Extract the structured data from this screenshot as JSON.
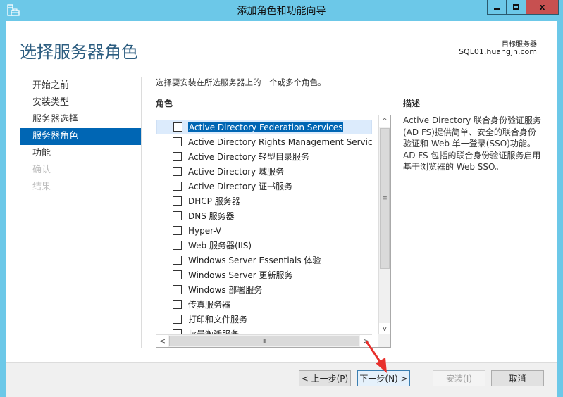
{
  "window": {
    "title": "添加角色和功能向导",
    "icon": "server-manager-icon",
    "controls": {
      "minimize": "minimize-icon",
      "maximize": "maximize-icon",
      "close": "x"
    }
  },
  "header": {
    "page_title": "选择服务器角色",
    "target_label": "目标服务器",
    "target_server": "SQL01.huangjh.com"
  },
  "nav": {
    "items": [
      {
        "label": "开始之前",
        "state": "normal"
      },
      {
        "label": "安装类型",
        "state": "normal"
      },
      {
        "label": "服务器选择",
        "state": "normal"
      },
      {
        "label": "服务器角色",
        "state": "active"
      },
      {
        "label": "功能",
        "state": "normal"
      },
      {
        "label": "确认",
        "state": "disabled"
      },
      {
        "label": "结果",
        "state": "disabled"
      }
    ]
  },
  "main": {
    "instruction": "选择要安装在所选服务器上的一个或多个角色。",
    "roles_heading": "角色",
    "roles": [
      {
        "label": "Active Directory Federation Services",
        "checked": false,
        "selected": true
      },
      {
        "label": "Active Directory Rights Management Services",
        "checked": false,
        "selected": false
      },
      {
        "label": "Active Directory 轻型目录服务",
        "checked": false,
        "selected": false
      },
      {
        "label": "Active Directory 域服务",
        "checked": false,
        "selected": false
      },
      {
        "label": "Active Directory 证书服务",
        "checked": false,
        "selected": false
      },
      {
        "label": "DHCP 服务器",
        "checked": false,
        "selected": false
      },
      {
        "label": "DNS 服务器",
        "checked": false,
        "selected": false
      },
      {
        "label": "Hyper-V",
        "checked": false,
        "selected": false
      },
      {
        "label": "Web 服务器(IIS)",
        "checked": false,
        "selected": false
      },
      {
        "label": "Windows Server Essentials 体验",
        "checked": false,
        "selected": false
      },
      {
        "label": "Windows Server 更新服务",
        "checked": false,
        "selected": false
      },
      {
        "label": "Windows 部署服务",
        "checked": false,
        "selected": false
      },
      {
        "label": "传真服务器",
        "checked": false,
        "selected": false
      },
      {
        "label": "打印和文件服务",
        "checked": false,
        "selected": false
      },
      {
        "label": "批量激活服务",
        "checked": false,
        "selected": false
      }
    ],
    "description_heading": "描述",
    "description": "Active Directory 联合身份验证服务(AD FS)提供简单、安全的联合身份验证和 Web 单一登录(SSO)功能。AD FS 包括的联合身份验证服务启用基于浏览器的 Web SSO。"
  },
  "scrollbars": {
    "up": "^",
    "down": "v",
    "left": "<",
    "right": ">",
    "grip_v": "≡",
    "grip_h": "III"
  },
  "buttons": {
    "previous": "< 上一步(P)",
    "next": "下一步(N) >",
    "install": "安装(I)",
    "cancel": "取消"
  },
  "annotation": {
    "type": "red-arrow",
    "color": "#e8302c",
    "points_to": "next-button"
  }
}
